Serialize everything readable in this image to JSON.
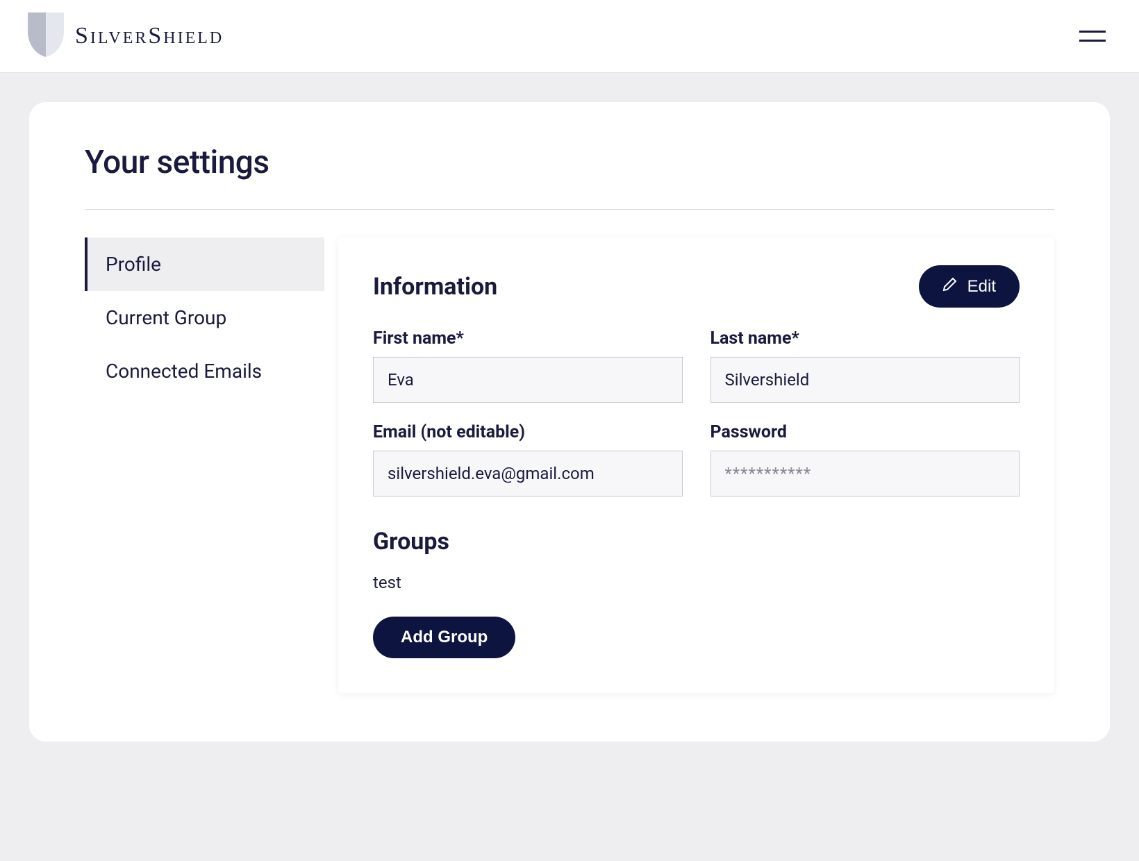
{
  "header": {
    "brand": "SilverShield"
  },
  "page": {
    "title": "Your settings"
  },
  "sidebar": {
    "items": [
      {
        "label": "Profile",
        "active": true
      },
      {
        "label": "Current Group",
        "active": false
      },
      {
        "label": "Connected Emails",
        "active": false
      }
    ]
  },
  "panel": {
    "section_title": "Information",
    "edit_label": "Edit",
    "fields": {
      "first_name": {
        "label": "First name*",
        "value": "Eva"
      },
      "last_name": {
        "label": "Last name*",
        "value": "Silvershield"
      },
      "email": {
        "label": "Email (not editable)",
        "value": "silvershield.eva@gmail.com"
      },
      "password": {
        "label": "Password",
        "placeholder": "***********"
      }
    },
    "groups": {
      "title": "Groups",
      "items": [
        "test"
      ],
      "add_label": "Add Group"
    }
  }
}
